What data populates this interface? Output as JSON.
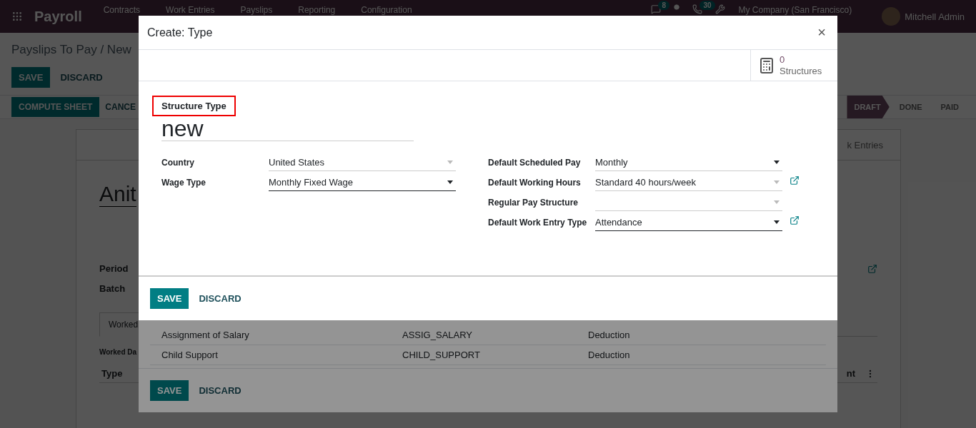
{
  "navbar": {
    "app_title": "Payroll",
    "menu": [
      "Contracts",
      "Work Entries",
      "Payslips",
      "Reporting",
      "Configuration"
    ],
    "chat_badge": "8",
    "call_badge": "30",
    "company": "My Company (San Francisco)",
    "user": "Mitchell Admin"
  },
  "page": {
    "breadcrumb": "Payslips To Pay / New",
    "buttons": [
      "SAVE",
      "DISCARD"
    ],
    "actions": [
      "COMPUTE SHEET",
      "CANCE"
    ],
    "stages": [
      {
        "label": "DRAFT",
        "selected": true
      },
      {
        "label": "DONE",
        "selected": false
      },
      {
        "label": "PAID",
        "selected": false
      }
    ],
    "smart_button": "k Entries",
    "employee": "Anit",
    "fields": [
      "Period",
      "Batch"
    ],
    "tab": "Worked",
    "section": "Worked Da",
    "table_columns": [
      "Type",
      "nt"
    ]
  },
  "list_dialog": {
    "rows": [
      {
        "name": "Assignment of Salary",
        "code": "ASSIG_SALARY",
        "category": "Deduction"
      },
      {
        "name": "Child Support",
        "code": "CHILD_SUPPORT",
        "category": "Deduction"
      }
    ],
    "buttons": [
      "SAVE",
      "DISCARD"
    ]
  },
  "dialog": {
    "title": "Create: Type",
    "close": "×",
    "stat": {
      "value": "0",
      "label": "Structures"
    },
    "name_label": "Structure Type",
    "name": "new",
    "left_fields": [
      {
        "label": "Country",
        "kind": "many2one",
        "value": "United States",
        "required": false,
        "external_link": false
      },
      {
        "label": "Wage Type",
        "kind": "selection",
        "value": "Monthly Fixed Wage",
        "required": true,
        "external_link": false
      }
    ],
    "right_fields": [
      {
        "label": "Default Scheduled Pay",
        "kind": "selection",
        "value": "Monthly",
        "required": false,
        "external_link": false
      },
      {
        "label": "Default Working Hours",
        "kind": "many2one",
        "value": "Standard 40 hours/week",
        "required": false,
        "external_link": true
      },
      {
        "label": "Regular Pay Structure",
        "kind": "many2one",
        "required": false,
        "external_link": false
      },
      {
        "label": "Default Work Entry Type",
        "kind": "many2one",
        "value": "Attendance",
        "required": true,
        "external_link": true
      }
    ],
    "buttons": [
      "SAVE",
      "DISCARD"
    ]
  }
}
